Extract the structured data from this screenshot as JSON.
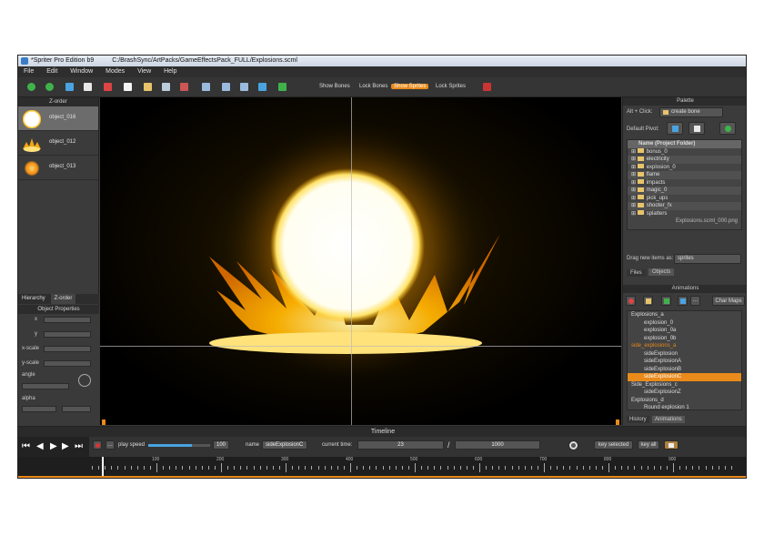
{
  "window": {
    "title": "*Spriter Pro Edition b9",
    "path": "C:/BrashSync/ArtPacks/GameEffectsPack_FULL/Explosions.scml"
  },
  "menu": [
    "File",
    "Edit",
    "Window",
    "Modes",
    "View",
    "Help"
  ],
  "toolbar": {
    "show_bones": "Show Bones",
    "lock_bones": "Lock Bones",
    "show_sprites": "Show Sprites",
    "lock_sprites": "Lock Sprites"
  },
  "zorder": {
    "title": "Z-order",
    "items": [
      {
        "label": "object_016"
      },
      {
        "label": "object_012"
      },
      {
        "label": "object_013"
      }
    ]
  },
  "left_tabs": {
    "hierarchy": "Hierarchy",
    "zorder": "Z-order"
  },
  "object_properties": {
    "title": "Object Properties",
    "x": "x",
    "y": "y",
    "xscale": "x-scale",
    "yscale": "y-scale",
    "angle": "angle",
    "alpha": "alpha"
  },
  "palette": {
    "title": "Palette",
    "alt_click": "Alt + Click:",
    "create_bone": "create bone",
    "default_pivot": "Default Pivot:",
    "tree_header": "Name    (Project Folder)",
    "folders": [
      "bonus_0",
      "electricity",
      "explosion_0",
      "flame",
      "impacts",
      "magic_0",
      "pick_ups",
      "shooter_fx",
      "splatters"
    ],
    "file_row": "Explosions.scml_000.png",
    "drag_label": "Drag new items as:",
    "drag_value": "sprites",
    "tab_files": "Files",
    "tab_objects": "Objects"
  },
  "animations": {
    "title": "Animations",
    "char_maps": "Char Maps",
    "rows": [
      {
        "label": "Explosions_a",
        "indent": 0,
        "style": "group"
      },
      {
        "label": "explosion_0",
        "indent": 1,
        "style": "normal"
      },
      {
        "label": "explosion_0a",
        "indent": 1,
        "style": "normal"
      },
      {
        "label": "explosion_0b",
        "indent": 1,
        "style": "normal"
      },
      {
        "label": "side_explosions_a",
        "indent": 0,
        "style": "orange"
      },
      {
        "label": "sideExplosion",
        "indent": 1,
        "style": "normal"
      },
      {
        "label": "sideExplosionA",
        "indent": 1,
        "style": "normal"
      },
      {
        "label": "sideExplosionB",
        "indent": 1,
        "style": "normal"
      },
      {
        "label": "sideExplosionC",
        "indent": 1,
        "style": "selected"
      },
      {
        "label": "Side_Explosions_c",
        "indent": 0,
        "style": "group"
      },
      {
        "label": "sideExplosionZ",
        "indent": 1,
        "style": "normal"
      },
      {
        "label": "Explosions_d",
        "indent": 0,
        "style": "group"
      },
      {
        "label": "Round explosion 1",
        "indent": 1,
        "style": "normal"
      }
    ],
    "tab_history": "History",
    "tab_animations": "Animations"
  },
  "timeline": {
    "title": "Timeline",
    "play_speed_label": "play speed",
    "play_speed_value": "100",
    "name_label": "name",
    "name_value": "sideExplosionC",
    "current_time_label": "current time:",
    "current_time": "23",
    "separator": "/",
    "total_time": "1000",
    "key_selected": "key selected",
    "key_all": "key all",
    "ruler": [
      "100",
      "200",
      "300",
      "400",
      "500",
      "600",
      "700",
      "800",
      "900"
    ],
    "playhead": "23"
  },
  "colors": {
    "accent": "#e98a1b",
    "panel": "#3b3b3b",
    "dark": "#2c2c2c"
  }
}
